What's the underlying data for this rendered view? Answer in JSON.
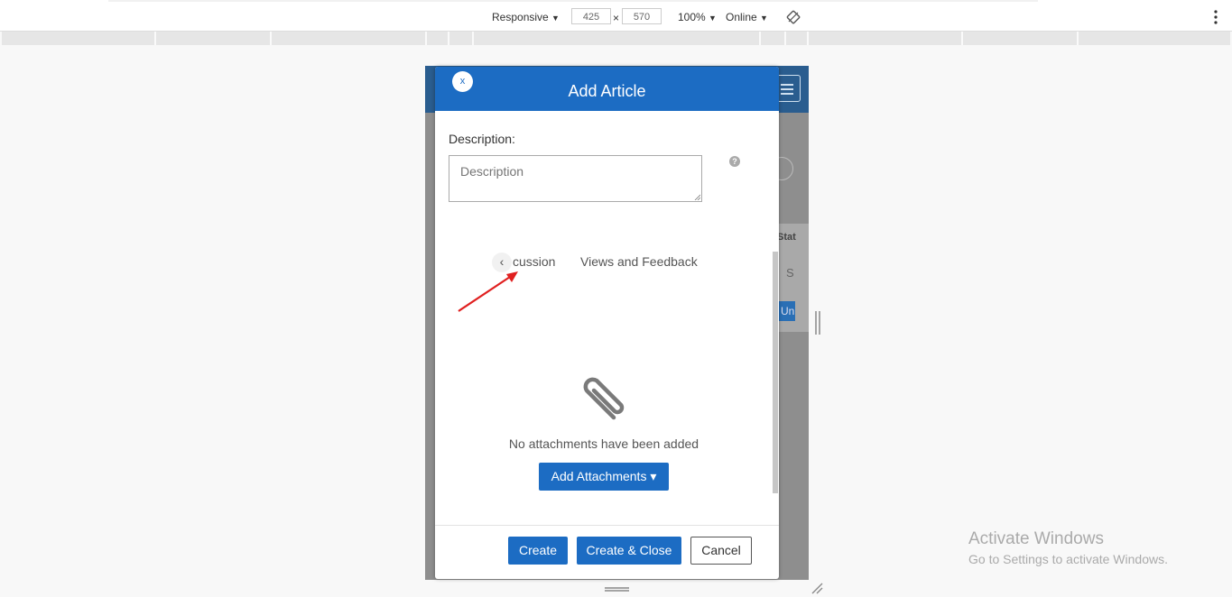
{
  "devtools": {
    "device_label": "Responsive",
    "width_value": "425",
    "dimension_separator": "×",
    "height_value": "570",
    "zoom_label": "100%",
    "throttle_label": "Online",
    "caret": "▼",
    "icons": [
      "rotate-icon",
      "more-vert-icon"
    ]
  },
  "background_page": {
    "column_header_fragment": "Stat",
    "cell_fragment": "S",
    "button_fragment": "Un"
  },
  "modal": {
    "title": "Add Article",
    "close_label": "x",
    "description_label": "Description:",
    "description_placeholder": "Description",
    "help_glyph": "?",
    "tab_prev_glyph": "‹",
    "tabs": [
      {
        "label": "cussion"
      },
      {
        "label": "Views and Feedback"
      }
    ],
    "attachments_empty_text": "No attachments have been added",
    "add_attachments_label": "Add Attachments",
    "dropdown_caret": "▾",
    "buttons": {
      "create": "Create",
      "create_close": "Create & Close",
      "cancel": "Cancel"
    },
    "accent_color": "#1c6cc3"
  },
  "annotation": {
    "color": "#e02020"
  },
  "watermark": {
    "title": "Activate Windows",
    "subtitle": "Go to Settings to activate Windows."
  }
}
